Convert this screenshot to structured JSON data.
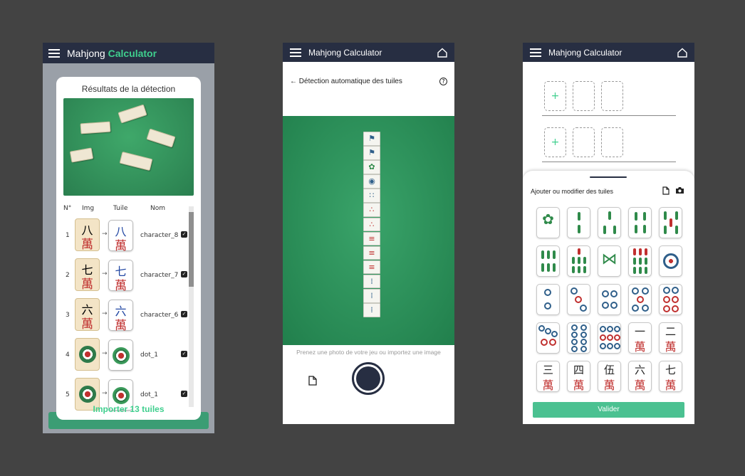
{
  "screen1": {
    "app_title_prefix": "Mahjong ",
    "app_title_accent": "Calculator",
    "dialog_title": "Résultats de la détection",
    "columns": [
      "N°",
      "Img",
      "Tuile",
      "Nom"
    ],
    "rows": [
      {
        "num": "1",
        "name": "character_8",
        "top": "八",
        "top_bound": "八",
        "kind": "character"
      },
      {
        "num": "2",
        "name": "character_7",
        "top": "七",
        "top_bound": "七",
        "kind": "character"
      },
      {
        "num": "3",
        "name": "character_6",
        "top": "六",
        "top_bound": "六",
        "kind": "character"
      },
      {
        "num": "4",
        "name": "dot_1",
        "kind": "dot"
      },
      {
        "num": "5",
        "name": "dot_1",
        "kind": "dot"
      }
    ],
    "arrow": "→",
    "import_label": "Importer 13 tuiles"
  },
  "screen2": {
    "app_title": "Mahjong Calculator",
    "page_title": "Détection automatique des tuiles",
    "help": "?",
    "prompt": "Prenez une photo de votre jeu ou importez une image"
  },
  "screen3": {
    "app_title": "Mahjong Calculator",
    "plus": "+",
    "sheet_title": "Ajouter ou modifier des tuiles",
    "validate_label": "Valider",
    "char_tiles": [
      "一",
      "二",
      "三",
      "四",
      "伍",
      "六",
      "七"
    ],
    "wan": "萬"
  },
  "colors": {
    "accent": "#3fcf8e",
    "navy": "#272e42",
    "felt": "#2f8f5a",
    "validate": "#4bc191"
  }
}
